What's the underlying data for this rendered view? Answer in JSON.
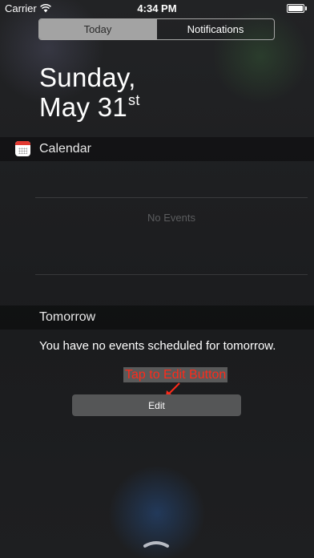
{
  "status_bar": {
    "carrier": "Carrier",
    "time": "4:34 PM"
  },
  "segmented": {
    "today": "Today",
    "notifications": "Notifications"
  },
  "date": {
    "line1": "Sunday,",
    "line2": "May 31",
    "suffix": "st"
  },
  "calendar": {
    "title": "Calendar",
    "empty_text": "No Events"
  },
  "tomorrow": {
    "title": "Tomorrow",
    "message": "You have no events scheduled for tomorrow."
  },
  "annotation": {
    "text": "Tap to Edit Button",
    "color": "#ff2a1a"
  },
  "edit_button": {
    "label": "Edit"
  },
  "icons": [
    "wifi-icon",
    "battery-icon",
    "calendar-app-icon",
    "arrow-icon",
    "grabber-chevron-icon"
  ]
}
